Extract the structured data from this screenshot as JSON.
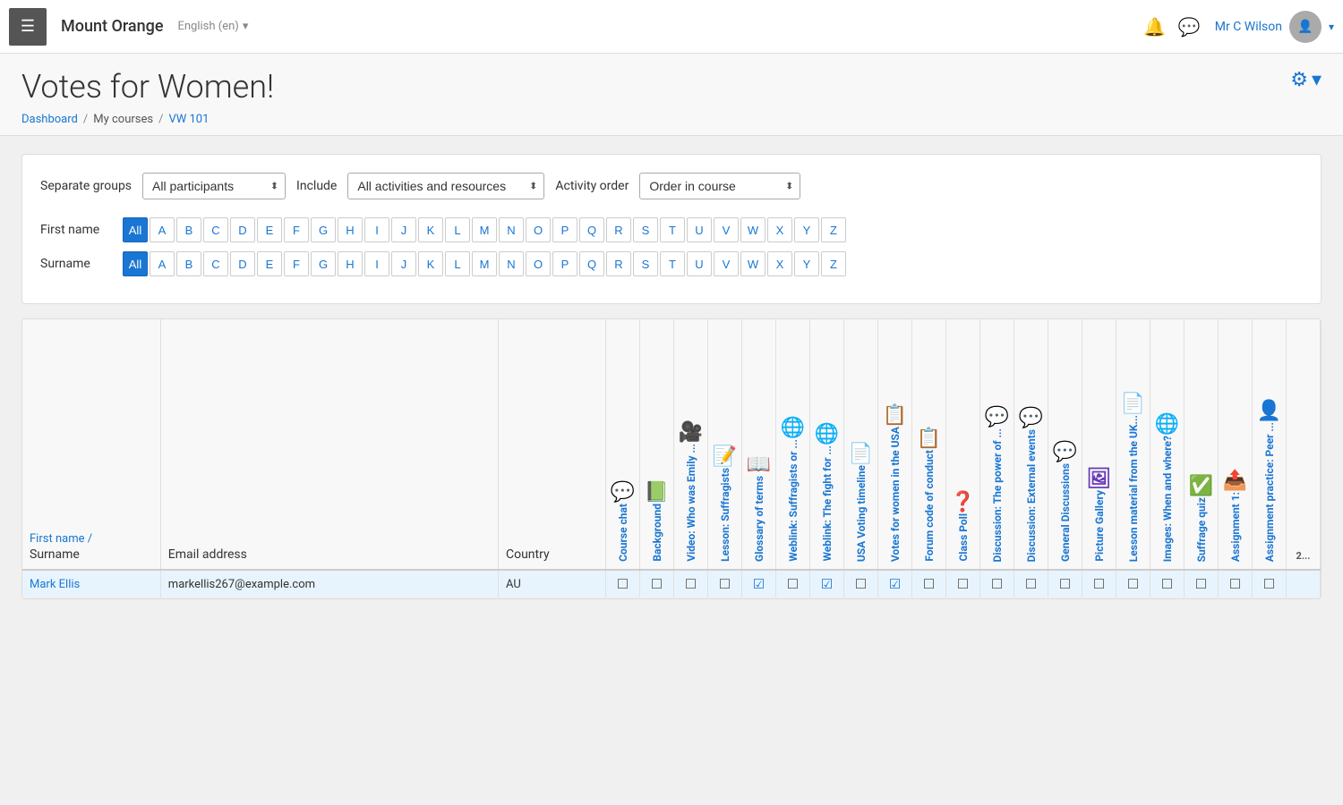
{
  "topnav": {
    "menu_label": "☰",
    "brand": "Mount Orange",
    "lang": "English (en)",
    "lang_arrow": "▾",
    "bell_icon": "🔔",
    "chat_icon": "💬",
    "user_name": "Mr C Wilson",
    "user_arrow": "▾"
  },
  "header": {
    "title": "Votes for Women!",
    "gear_icon": "⚙",
    "gear_arrow": "▾",
    "breadcrumbs": [
      {
        "label": "Dashboard",
        "link": true
      },
      {
        "label": "My courses",
        "link": false
      },
      {
        "label": "VW 101",
        "link": true
      }
    ]
  },
  "filters": {
    "separate_groups_label": "Separate groups",
    "separate_groups_value": "All participants",
    "include_label": "Include",
    "include_value": "All activities and resources",
    "activity_order_label": "Activity order",
    "activity_order_value": "Order in course"
  },
  "firstname_filter": {
    "label": "First name",
    "letters": [
      "All",
      "A",
      "B",
      "C",
      "D",
      "E",
      "F",
      "G",
      "H",
      "I",
      "J",
      "K",
      "L",
      "M",
      "N",
      "O",
      "P",
      "Q",
      "R",
      "S",
      "T",
      "U",
      "V",
      "W",
      "X",
      "Y",
      "Z"
    ],
    "active": "All"
  },
  "surname_filter": {
    "label": "Surname",
    "letters": [
      "All",
      "A",
      "B",
      "C",
      "D",
      "E",
      "F",
      "G",
      "H",
      "I",
      "J",
      "K",
      "L",
      "M",
      "N",
      "O",
      "P",
      "Q",
      "R",
      "S",
      "T",
      "U",
      "V",
      "W",
      "X",
      "Y",
      "Z"
    ],
    "active": "All"
  },
  "table": {
    "col_firstname_label": "First name /",
    "col_surname_label": "Surname",
    "col_email_label": "Email address",
    "col_country_label": "Country",
    "columns": [
      {
        "name": "course-chat",
        "label": "Course chat",
        "icon": "💬",
        "icon_class": "icon-chat"
      },
      {
        "name": "background",
        "label": "Background",
        "icon": "📗",
        "icon_class": "icon-book"
      },
      {
        "name": "video-emily",
        "label": "Video: Who was Emily ...",
        "icon": "📋",
        "icon_class": "icon-assignment"
      },
      {
        "name": "lesson-suffragists",
        "label": "Lesson: Suffragists",
        "icon": "📋",
        "icon_class": "icon-assignment"
      },
      {
        "name": "glossary",
        "label": "Glossary of terms",
        "icon": "📄",
        "icon_class": "icon-page"
      },
      {
        "name": "weblink-suffragists",
        "label": "Weblink: Suffragists or ...",
        "icon": "🔗",
        "icon_class": "icon-weblink"
      },
      {
        "name": "weblink-fight",
        "label": "Weblink: The fight for ...",
        "icon": "🔗",
        "icon_class": "icon-weblink2"
      },
      {
        "name": "usa-timeline",
        "label": "USA Voting timeline",
        "icon": "📄",
        "icon_class": "icon-timeline"
      },
      {
        "name": "votes-women-usa",
        "label": "Votes for women in the USA",
        "icon": "📋",
        "icon_class": "icon-forum"
      },
      {
        "name": "forum-conduct",
        "label": "Forum code of conduct",
        "icon": "📋",
        "icon_class": "icon-forum2"
      },
      {
        "name": "class-poll",
        "label": "Class Poll",
        "icon": "❓",
        "icon_class": "icon-question"
      },
      {
        "name": "discussion-power",
        "label": "Discussion: The power of ...",
        "icon": "💬",
        "icon_class": "icon-discussion"
      },
      {
        "name": "discussion-external",
        "label": "Discussion: External events",
        "icon": "💬",
        "icon_class": "icon-discussion2"
      },
      {
        "name": "general-discussions",
        "label": "General Discussions",
        "icon": "💬",
        "icon_class": "icon-general"
      },
      {
        "name": "picture-gallery",
        "label": "Picture Gallery",
        "icon": "🖼",
        "icon_class": "icon-gallery"
      },
      {
        "name": "lesson-uk",
        "label": "Lesson material from the UK...",
        "icon": "📄",
        "icon_class": "icon-lesson"
      },
      {
        "name": "images-when",
        "label": "Images: When and where?",
        "icon": "🔗",
        "icon_class": "icon-images"
      },
      {
        "name": "suffrage-quiz",
        "label": "Suffrage quiz",
        "icon": "✅",
        "icon_class": "icon-quiz"
      },
      {
        "name": "assignment1",
        "label": "Assignment 1:",
        "icon": "📤",
        "icon_class": "icon-peer"
      },
      {
        "name": "peer-assignment",
        "label": "Assignment practice: Peer ...",
        "icon": "👤",
        "icon_class": "icon-peer"
      }
    ],
    "rows": [
      {
        "firstname": "Mark Ellis",
        "email": "markellis267@example.com",
        "country": "AU",
        "checks": [
          false,
          false,
          false,
          false,
          true,
          false,
          true,
          false,
          true,
          false,
          false,
          false,
          false,
          false,
          false,
          false,
          false,
          false,
          false,
          false
        ]
      }
    ]
  }
}
